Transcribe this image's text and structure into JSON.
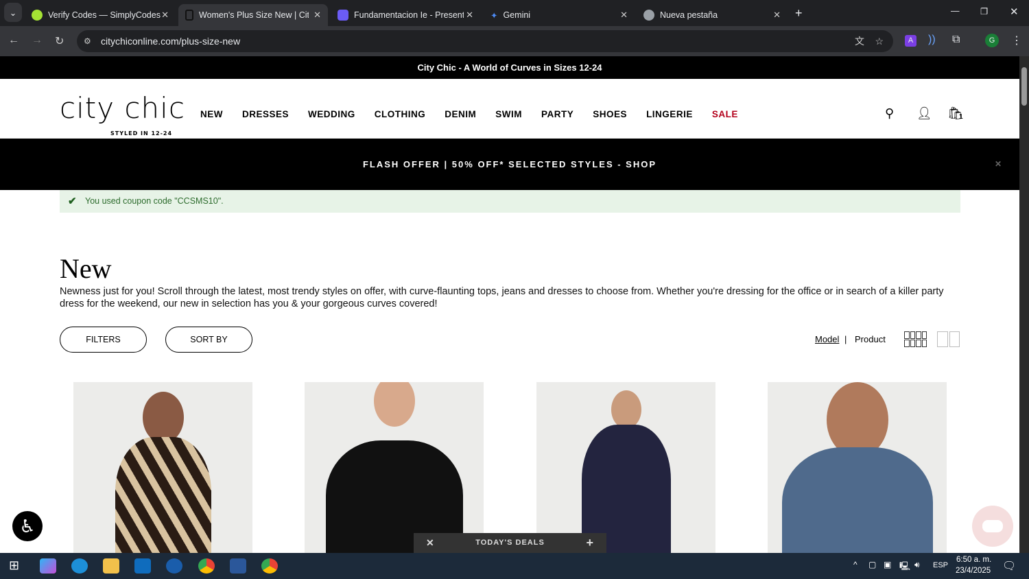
{
  "browser": {
    "tabs": [
      {
        "title": "Verify Codes — SimplyCodes",
        "active": false,
        "color": "#a4e234"
      },
      {
        "title": "Women's Plus Size New | City C",
        "active": true,
        "color": "#222222"
      },
      {
        "title": "Fundamentacion Ie - Presentati",
        "active": false,
        "color": "#6b5cf6"
      },
      {
        "title": "Gemini",
        "active": false,
        "color": "#4d8bf5"
      },
      {
        "title": "Nueva pestaña",
        "active": false,
        "color": "#9aa0a6"
      }
    ],
    "url": "citychiconline.com/plus-size-new"
  },
  "promo_bar": "City Chic - A World of Curves in Sizes 12-24",
  "logo": {
    "name": "city chic",
    "tagline": "STYLED IN 12-24"
  },
  "menu": [
    "NEW",
    "DRESSES",
    "WEDDING",
    "CLOTHING",
    "DENIM",
    "SWIM",
    "PARTY",
    "SHOES",
    "LINGERIE",
    "SALE"
  ],
  "cart_count": "1",
  "flash_offer": "FLASH OFFER | 50% OFF* SELECTED STYLES - SHOP",
  "coupon_message": "You used coupon code \"CCSMS10\".",
  "page": {
    "title": "New",
    "description": "Newness just for you! Scroll through the latest, most trendy styles on offer, with curve-flaunting tops, jeans and dresses to choose from. Whether you're dressing for the office or in search of a killer party dress for the weekend, our new in selection has you & your gorgeous curves covered!"
  },
  "controls": {
    "filters": "FILTERS",
    "sort_by": "SORT BY",
    "view_model": "Model",
    "view_sep": "|",
    "view_product": "Product"
  },
  "deals": {
    "label": "TODAY'S DEALS"
  },
  "taskbar": {
    "lang": "ESP",
    "time": "6:50 a. m.",
    "date": "23/4/2025"
  }
}
